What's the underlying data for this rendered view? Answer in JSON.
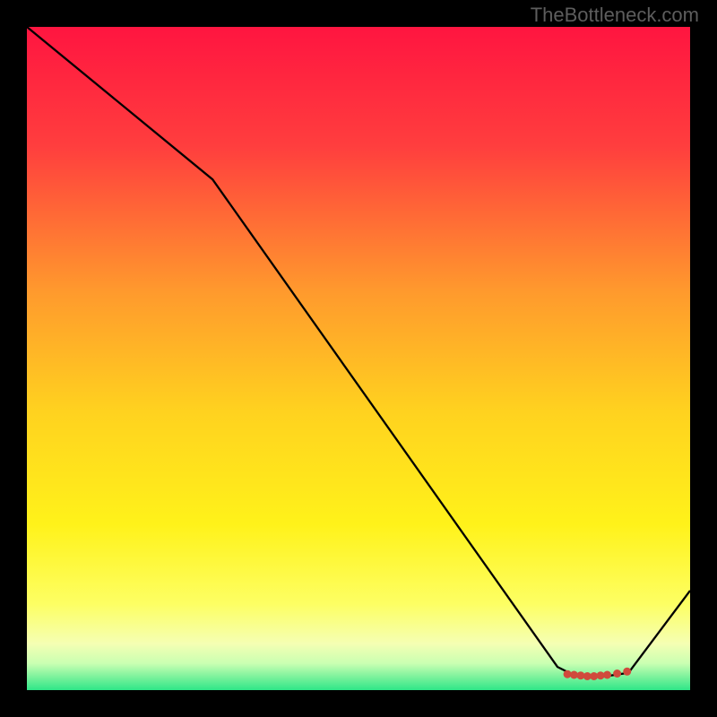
{
  "watermark": "TheBottleneck.com",
  "chart_data": {
    "type": "line",
    "title": "",
    "xlabel": "",
    "ylabel": "",
    "xlim": [
      0,
      100
    ],
    "ylim": [
      0,
      100
    ],
    "x": [
      0,
      28,
      80,
      82,
      84,
      86,
      88,
      90,
      91,
      100
    ],
    "values": [
      100,
      77,
      3.5,
      2.5,
      2.2,
      2.0,
      2.2,
      2.5,
      3.0,
      15
    ],
    "annotation_points_x": [
      81.5,
      82.5,
      83.5,
      84.5,
      85.5,
      86.5,
      87.5,
      89.0,
      90.5
    ],
    "annotation_points_y": [
      2.4,
      2.3,
      2.2,
      2.1,
      2.1,
      2.2,
      2.3,
      2.5,
      2.8
    ],
    "annotation_color": "#d04a3c",
    "background_kind": "vertical_gradient_red_yellow_green",
    "gradient_stops": [
      {
        "offset": 0,
        "color": "#ff1540"
      },
      {
        "offset": 18,
        "color": "#ff3e3e"
      },
      {
        "offset": 40,
        "color": "#ff9a2d"
      },
      {
        "offset": 58,
        "color": "#ffd21f"
      },
      {
        "offset": 75,
        "color": "#fff21a"
      },
      {
        "offset": 87,
        "color": "#fdff63"
      },
      {
        "offset": 93,
        "color": "#f5ffb3"
      },
      {
        "offset": 96,
        "color": "#c9ffb2"
      },
      {
        "offset": 98,
        "color": "#7cf29c"
      },
      {
        "offset": 100,
        "color": "#2fe688"
      }
    ]
  }
}
